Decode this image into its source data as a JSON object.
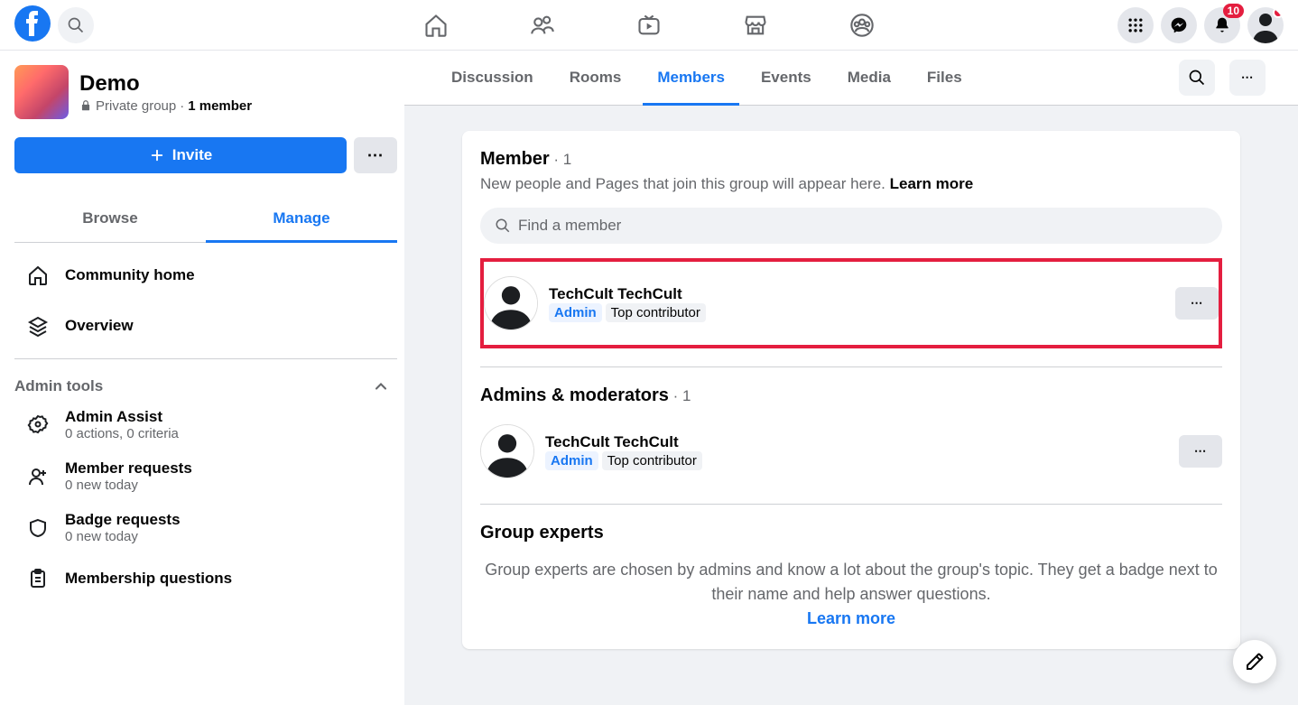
{
  "header": {
    "notification_count": "10"
  },
  "group": {
    "name": "Demo",
    "privacy": "Private group",
    "member_count": "1 member",
    "invite_label": "Invite"
  },
  "sidebar_tabs": {
    "browse": "Browse",
    "manage": "Manage"
  },
  "sidebar_items": {
    "community_home": "Community home",
    "overview": "Overview"
  },
  "admin_tools": {
    "header": "Admin tools",
    "admin_assist": {
      "label": "Admin Assist",
      "sub": "0 actions, 0 criteria"
    },
    "member_requests": {
      "label": "Member requests",
      "sub": "0 new today"
    },
    "badge_requests": {
      "label": "Badge requests",
      "sub": "0 new today"
    },
    "membership_questions": {
      "label": "Membership questions"
    }
  },
  "group_tabs": [
    "Discussion",
    "Rooms",
    "Members",
    "Events",
    "Media",
    "Files"
  ],
  "members_section": {
    "title": "Member",
    "count": " · 1",
    "desc": "New people and Pages that join this group will appear here. ",
    "learn_more": "Learn more",
    "search_placeholder": "Find a member"
  },
  "member_list": [
    {
      "name": "TechCult TechCult",
      "badge1": "Admin",
      "badge2": "Top contributor"
    }
  ],
  "admins_section": {
    "title": "Admins & moderators",
    "count": " · 1"
  },
  "admin_list": [
    {
      "name": "TechCult TechCult",
      "badge1": "Admin",
      "badge2": "Top contributor"
    }
  ],
  "experts_section": {
    "title": "Group experts",
    "desc": "Group experts are chosen by admins and know a lot about the group's topic. They get a badge next to their name and help answer questions.",
    "learn_more": "Learn more"
  }
}
